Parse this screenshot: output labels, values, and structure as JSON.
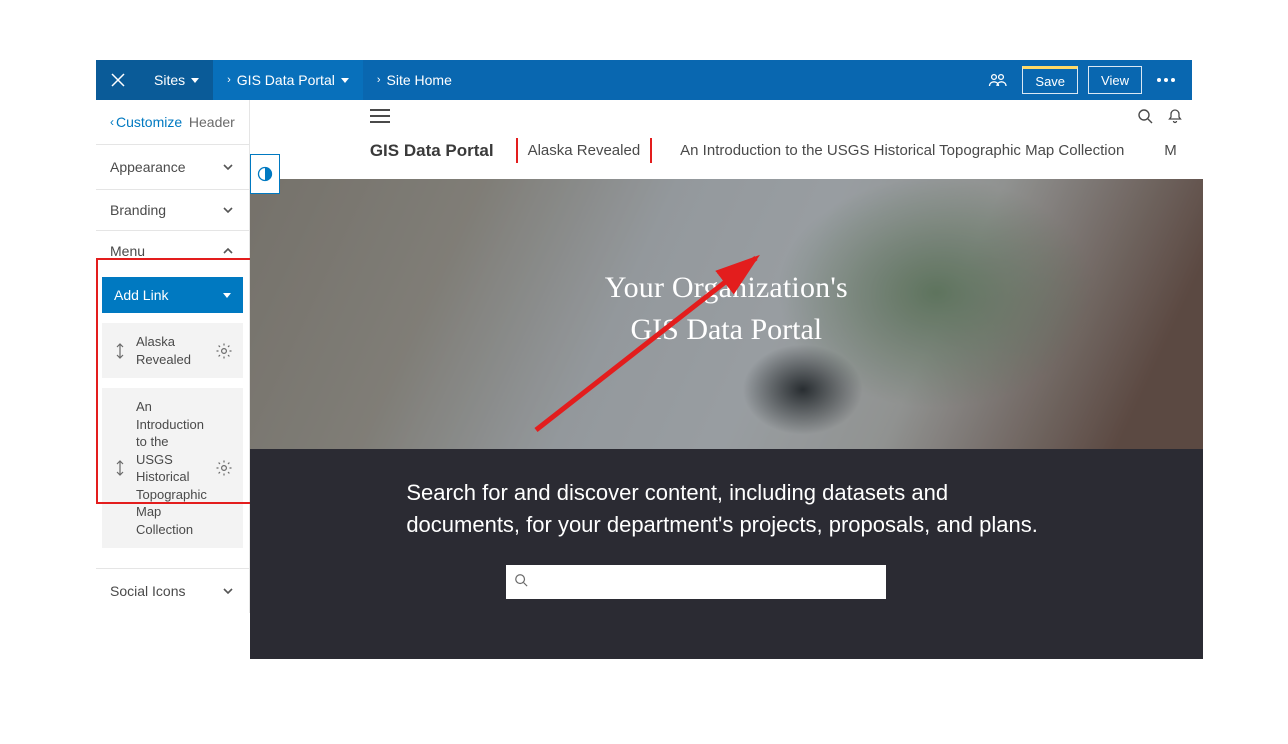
{
  "topbar": {
    "sites_label": "Sites",
    "portal_label": "GIS Data Portal",
    "sitehome_label": "Site Home",
    "save_label": "Save",
    "view_label": "View"
  },
  "sidebar": {
    "back_label": "Customize",
    "header_title": "Header",
    "sections": {
      "appearance": "Appearance",
      "branding": "Branding",
      "menu": "Menu",
      "social": "Social Icons"
    },
    "add_link_label": "Add Link",
    "links": [
      {
        "label": "Alaska Revealed"
      },
      {
        "label": "An Introduction to the USGS Historical Topographic Map Collection"
      }
    ]
  },
  "preview": {
    "brand": "GIS Data Portal",
    "nav": [
      "Alaska Revealed",
      "An Introduction to the USGS Historical Topographic Map Collection",
      "M"
    ],
    "hero_line1": "Your Organization's",
    "hero_line2": "GIS Data Portal",
    "band_text": "Search for and discover content, including datasets and documents, for your department's projects, proposals, and plans.",
    "search_placeholder": ""
  }
}
